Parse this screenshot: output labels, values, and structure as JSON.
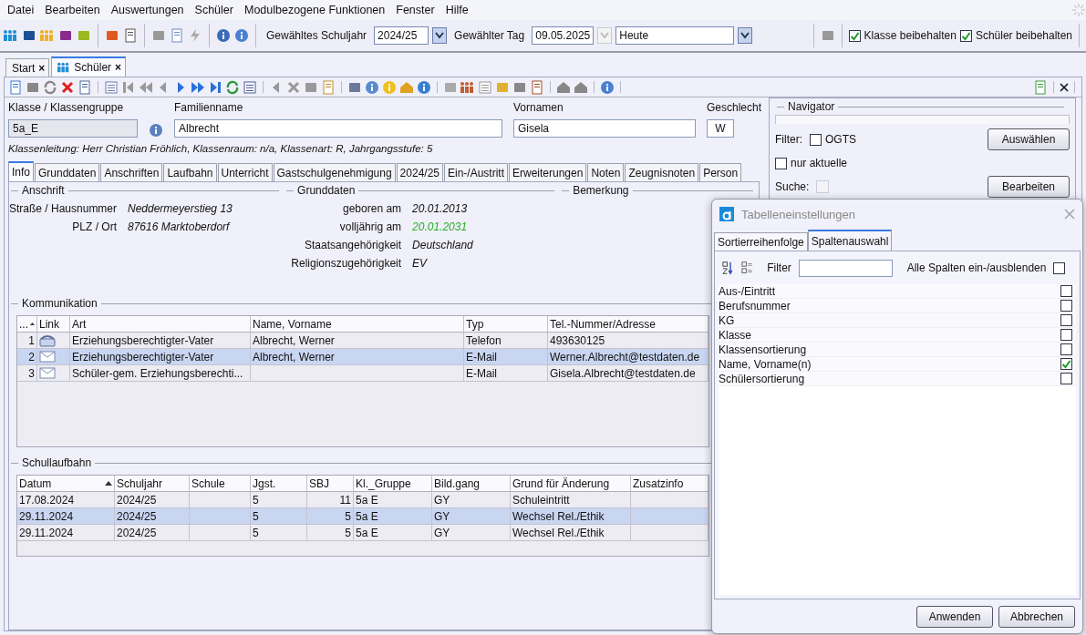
{
  "menu": [
    "Datei",
    "Bearbeiten",
    "Auswertungen",
    "Schüler",
    "Modulbezogene Funktionen",
    "Fenster",
    "Hilfe"
  ],
  "toolbar": {
    "schuljahr_label": "Gewähltes Schuljahr",
    "schuljahr": "2024/25",
    "tag_label": "Gewählter Tag",
    "tag": "09.05.2025",
    "zeitraum": "Heute",
    "options": [
      {
        "label": "Klasse beibehalten",
        "checked": true
      },
      {
        "label": "Schüler beibehalten",
        "checked": true
      }
    ]
  },
  "doc_tabs": [
    {
      "label": "Start",
      "selected": false,
      "close": "×"
    },
    {
      "label": "Schüler",
      "selected": true,
      "close": "×"
    }
  ],
  "student": {
    "fields": [
      {
        "label": "Klasse / Klassengruppe",
        "value": "5a_E"
      },
      {
        "label": "Familienname",
        "value": "Albrecht"
      },
      {
        "label": "Vornamen",
        "value": "Gisela"
      },
      {
        "label": "Geschlecht",
        "value": "W"
      }
    ],
    "info": "Klassenleitung: Herr Christian Fröhlich, Klassenraum: n/a, Klassenart: R, Jahrgangsstufe: 5"
  },
  "tabs": [
    {
      "label": "Info",
      "selected": true
    },
    {
      "label": "Grunddaten",
      "selected": false
    },
    {
      "label": "Anschriften",
      "selected": false
    },
    {
      "label": "Laufbahn",
      "selected": false
    },
    {
      "label": "Unterricht",
      "selected": false
    },
    {
      "label": "Gastschulgenehmigung",
      "selected": false
    },
    {
      "label": "2024/25",
      "selected": false
    },
    {
      "label": "Ein-/Austritt",
      "selected": false
    },
    {
      "label": "Erweiterungen",
      "selected": false
    },
    {
      "label": "Noten",
      "selected": false
    },
    {
      "label": "Zeugnisnoten",
      "selected": false
    },
    {
      "label": "Person",
      "selected": false
    }
  ],
  "anschrift": {
    "title": "Anschrift",
    "rows": [
      {
        "label": "Straße / Hausnummer",
        "value": "Neddermeyerstieg 13"
      },
      {
        "label": "PLZ / Ort",
        "value": "87616 Marktoberdorf"
      }
    ]
  },
  "grunddaten": {
    "title": "Grunddaten",
    "rows": [
      {
        "label": "geboren am",
        "value": "20.01.2013",
        "highlight": false
      },
      {
        "label": "volljährig am",
        "value": "20.01.2031",
        "highlight": true
      },
      {
        "label": "Staatsangehörigkeit",
        "value": "Deutschland",
        "highlight": false
      },
      {
        "label": "Religionszugehörigkeit",
        "value": "EV",
        "highlight": false
      }
    ]
  },
  "bemerkung": {
    "title": "Bemerkung"
  },
  "kommunikation": {
    "title": "Kommunikation",
    "columns": [
      {
        "label": "...",
        "sorted": true
      },
      {
        "label": "Link",
        "sorted": false
      },
      {
        "label": "Art",
        "sorted": false
      },
      {
        "label": "Name, Vorname",
        "sorted": false
      },
      {
        "label": "Typ",
        "sorted": false
      },
      {
        "label": "Tel.-Nummer/Adresse",
        "sorted": false
      }
    ],
    "rows": [
      {
        "nr": "1",
        "kind": "phone",
        "art": "Erziehungsberechtigter-Vater",
        "name": "Albrecht, Werner",
        "typ": "Telefon",
        "adresse": "493630125",
        "selected": false
      },
      {
        "nr": "2",
        "kind": "mail",
        "art": "Erziehungsberechtigter-Vater",
        "name": "Albrecht, Werner",
        "typ": "E-Mail",
        "adresse": "Werner.Albrecht@testdaten.de",
        "selected": true
      },
      {
        "nr": "3",
        "kind": "mail",
        "art": "Schüler-gem. Erziehungsberechti...",
        "typ": "E-Mail",
        "adresse": "Gisela.Albrecht@testdaten.de",
        "selected": false
      }
    ]
  },
  "schullaufbahn": {
    "title": "Schullaufbahn",
    "columns": [
      {
        "label": "Datum",
        "sorted": true
      },
      {
        "label": "Schuljahr",
        "sorted": false
      },
      {
        "label": "Schule",
        "sorted": false
      },
      {
        "label": "Jgst.",
        "sorted": false
      },
      {
        "label": "SBJ",
        "sorted": false
      },
      {
        "label": "Kl._Gruppe",
        "sorted": false
      },
      {
        "label": "Bild.gang",
        "sorted": false
      },
      {
        "label": "Grund für Änderung",
        "sorted": false
      },
      {
        "label": "Zusatzinfo",
        "sorted": false
      }
    ],
    "rows": [
      {
        "datum": "17.08.2024",
        "schuljahr": "2024/25",
        "jgst": "5",
        "sbj": "11",
        "klasse": "5a E",
        "bildgang": "GY",
        "grund": "Schuleintritt",
        "selected": false
      },
      {
        "datum": "29.11.2024",
        "schuljahr": "2024/25",
        "jgst": "5",
        "sbj": "5",
        "klasse": "5a E",
        "bildgang": "GY",
        "grund": "Wechsel Rel./Ethik",
        "selected": true
      },
      {
        "datum": "29.11.2024",
        "schuljahr": "2024/25",
        "jgst": "5",
        "sbj": "5",
        "klasse": "5a E",
        "bildgang": "GY",
        "grund": "Wechsel Rel./Ethik",
        "selected": false
      }
    ]
  },
  "navigator": {
    "title": "Navigator",
    "filter_label": "Filter:",
    "ogts": {
      "label": "OGTS",
      "checked": false
    },
    "nur_aktuelle": {
      "label": "nur aktuelle",
      "checked": false
    },
    "suche_label": "Suche:",
    "buttons": [
      "Auswählen",
      "Bearbeiten"
    ]
  },
  "dialog": {
    "title": "Tabelleneinstellungen",
    "tabs": [
      {
        "label": "Sortierreihenfolge",
        "selected": false
      },
      {
        "label": "Spaltenauswahl",
        "selected": true
      }
    ],
    "filter_label": "Filter",
    "all_label": "Alle Spalten ein-/ausblenden",
    "all_checked": false,
    "columns": [
      {
        "label": "Aus-/Eintritt",
        "checked": false
      },
      {
        "label": "Berufsnummer",
        "checked": false
      },
      {
        "label": "KG",
        "checked": false
      },
      {
        "label": "Klasse",
        "checked": false
      },
      {
        "label": "Klassensortierung",
        "checked": false
      },
      {
        "label": "Name, Vorname(n)",
        "checked": true
      },
      {
        "label": "Schülersortierung",
        "checked": false
      }
    ],
    "buttons": [
      "Anwenden",
      "Abbrechen"
    ]
  }
}
